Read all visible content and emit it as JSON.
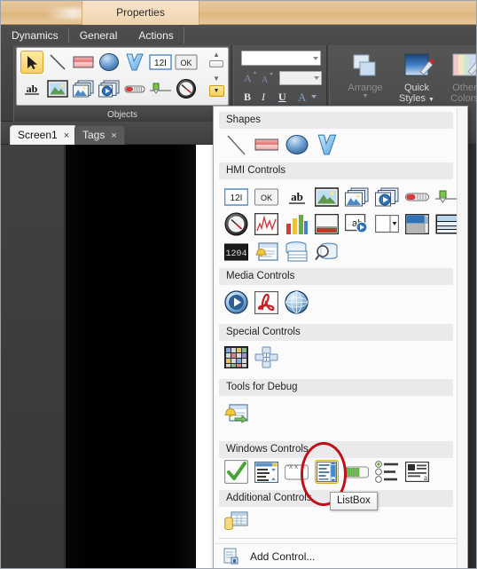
{
  "window": {
    "contextual_tab": "Properties"
  },
  "ribbon": {
    "tabs": [
      {
        "label": "Dynamics"
      },
      {
        "label": "General"
      },
      {
        "label": "Actions"
      }
    ],
    "groups": {
      "objects": {
        "label": "Objects",
        "row1": [
          {
            "name": "select-arrow-icon",
            "selected": true
          },
          {
            "name": "line-icon",
            "selected": false
          },
          {
            "name": "rectangle-icon",
            "selected": false
          },
          {
            "name": "ellipse-icon",
            "selected": false
          },
          {
            "name": "polygon-icon",
            "selected": false
          },
          {
            "name": "numeric-display-icon",
            "label": "12I",
            "selected": false
          },
          {
            "name": "button-icon",
            "label": "OK",
            "selected": false
          }
        ],
        "row2": [
          {
            "name": "text-icon",
            "label": "ab",
            "selected": false
          },
          {
            "name": "image-icon",
            "selected": false
          },
          {
            "name": "image-list-icon",
            "selected": false
          },
          {
            "name": "media-list-icon",
            "selected": false
          },
          {
            "name": "thermometer-icon",
            "selected": false
          },
          {
            "name": "slider-icon",
            "selected": false
          },
          {
            "name": "gauge-icon",
            "selected": false
          }
        ],
        "scroll_up": "▲",
        "scroll_down": "▼",
        "more_arrow": "▼"
      },
      "font": {
        "font_name_value": "",
        "font_size_value": "",
        "grow_font_label": "A",
        "shrink_font_label": "A",
        "bold_label": "B",
        "italic_label": "I",
        "underline_label": "U",
        "font_color_label": "A"
      },
      "styles": {
        "arrange_label": "Arrange",
        "quick_styles_label_line1": "Quick",
        "quick_styles_label_line2": "Styles",
        "other_colors_label_line1": "Other",
        "other_colors_label_line2": "Colors"
      }
    }
  },
  "document_tabs": [
    {
      "label": "Screen1",
      "close": "×",
      "active": true
    },
    {
      "label": "Tags",
      "close": "×",
      "active": false
    }
  ],
  "gallery": {
    "sections": [
      {
        "header": "Shapes",
        "items": [
          {
            "name": "line-icon"
          },
          {
            "name": "rectangle-icon"
          },
          {
            "name": "ellipse-icon"
          },
          {
            "name": "polygon-icon"
          }
        ]
      },
      {
        "header": "HMI Controls",
        "rows": [
          [
            {
              "name": "numeric-display-icon",
              "label": "12I"
            },
            {
              "name": "button-icon",
              "label": "OK"
            },
            {
              "name": "text-icon",
              "label": "ab"
            },
            {
              "name": "image-icon"
            },
            {
              "name": "image-list-icon"
            },
            {
              "name": "media-list-icon"
            },
            {
              "name": "thermometer-icon"
            },
            {
              "name": "slider-icon"
            }
          ],
          [
            {
              "name": "gauge-icon"
            },
            {
              "name": "trend-chart-icon"
            },
            {
              "name": "bar-chart-icon"
            },
            {
              "name": "panel-icon"
            },
            {
              "name": "animated-text-icon",
              "label": "ab"
            },
            {
              "name": "combo-box-icon"
            },
            {
              "name": "scroll-panel-icon"
            },
            {
              "name": "group-box-icon"
            }
          ],
          [
            {
              "name": "seven-segment-display-icon",
              "label": "1204"
            },
            {
              "name": "alarm-window-icon"
            },
            {
              "name": "database-grid-icon"
            },
            {
              "name": "database-query-icon"
            }
          ]
        ]
      },
      {
        "header": "Media Controls",
        "items": [
          {
            "name": "media-player-icon"
          },
          {
            "name": "pdf-viewer-icon"
          },
          {
            "name": "web-browser-icon"
          }
        ]
      },
      {
        "header": "Special Controls",
        "items": [
          {
            "name": "keypad-icon"
          },
          {
            "name": "symbol-factory-icon"
          }
        ]
      },
      {
        "header": "Tools for Debug",
        "items": [
          {
            "name": "debug-alarm-icon"
          }
        ]
      },
      {
        "header": "Windows Controls",
        "items": [
          {
            "name": "check-box-icon"
          },
          {
            "name": "data-grid-icon"
          },
          {
            "name": "text-box-icon"
          },
          {
            "name": "list-box-icon",
            "selected": true
          },
          {
            "name": "progress-bar-icon"
          },
          {
            "name": "radio-button-icon"
          },
          {
            "name": "rich-text-icon"
          }
        ]
      },
      {
        "header": "Additional Controls",
        "items": [
          {
            "name": "recipe-grid-icon"
          }
        ]
      }
    ],
    "add_control": {
      "label": "Add Control...",
      "icon": "add-control-icon"
    }
  },
  "tooltip": {
    "text": "ListBox"
  },
  "annotation": {
    "shape": "ellipse",
    "color": "#c00f16",
    "target": "list-box-icon"
  },
  "colors": {
    "contextual_tab": "#e3bd8c",
    "ribbon_bg": "#464646",
    "canvas": "#000000",
    "highlight": "#fbd87f",
    "annotation_red": "#c00f16"
  }
}
